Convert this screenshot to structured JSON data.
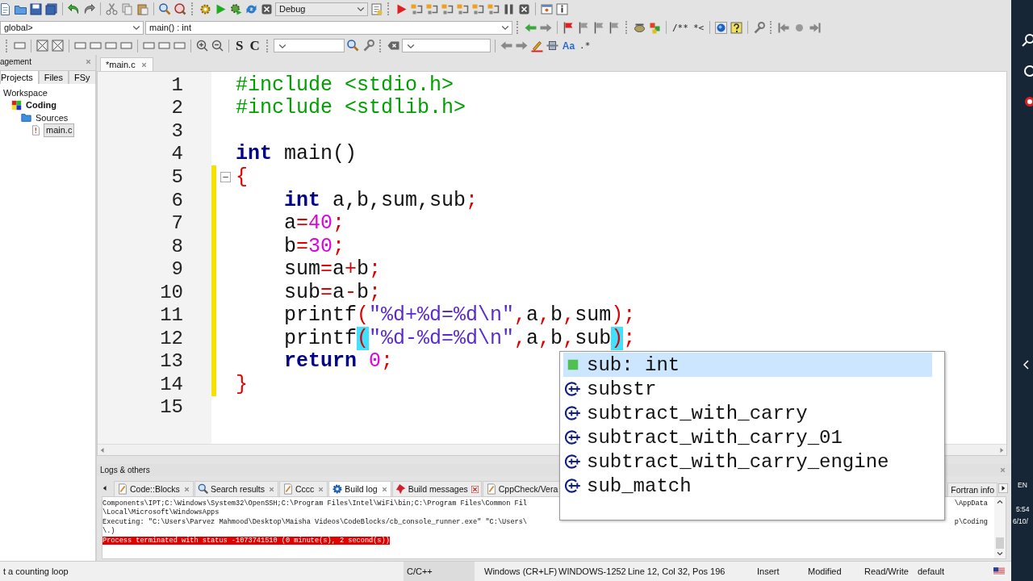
{
  "toolbar_rows": [
    {
      "texts": [
        "Debug"
      ]
    },
    {
      "texts": [
        "global>",
        "main() : int",
        "/**",
        "*<"
      ]
    },
    {
      "texts": [
        "S",
        "C",
        "Aa",
        ".*"
      ]
    }
  ],
  "management_panel": {
    "title": "agement",
    "tabs": [
      {
        "label": "Projects",
        "selected": true
      },
      {
        "label": "Files",
        "selected": false
      },
      {
        "label": "FSy",
        "selected": false
      }
    ],
    "tree": [
      {
        "label": "Workspace",
        "selected": false,
        "children": [
          {
            "label": "Coding",
            "kind": "project",
            "selected": false,
            "children": [
              {
                "label": "Sources",
                "kind": "folder",
                "selected": false,
                "children": [
                  {
                    "label": "main.c",
                    "kind": "file",
                    "selected": true
                  }
                ]
              }
            ]
          }
        ]
      }
    ]
  },
  "editor": {
    "tabs": [
      {
        "label": "*main.c",
        "selected": true
      }
    ],
    "lines": [
      {
        "number": "1",
        "changed": false,
        "fold": false,
        "indent": false,
        "tokens": [
          {
            "kind": "preproc",
            "text": "#include <stdio.h>"
          }
        ]
      },
      {
        "number": "2",
        "changed": false,
        "fold": false,
        "indent": false,
        "tokens": [
          {
            "kind": "preproc",
            "text": "#include <stdlib.h>"
          }
        ]
      },
      {
        "number": "3",
        "changed": false,
        "fold": false,
        "indent": false
      },
      {
        "number": "4",
        "changed": false,
        "fold": false,
        "indent": false,
        "tokens": [
          {
            "kind": "keyword",
            "text": "int"
          },
          {
            "kind": "plain",
            "text": " main()"
          }
        ]
      },
      {
        "number": "5",
        "changed": true,
        "fold": true,
        "indent": false,
        "tokens": [
          {
            "kind": "operator",
            "text": "{"
          }
        ]
      },
      {
        "number": "6",
        "changed": true,
        "fold": false,
        "indent": true,
        "tokens": [
          {
            "kind": "keyword",
            "text": "int"
          },
          {
            "kind": "plain",
            "text": " a,b,sum,sub"
          },
          {
            "kind": "operator",
            "text": ";"
          }
        ]
      },
      {
        "number": "7",
        "changed": true,
        "fold": false,
        "indent": true,
        "tokens": [
          {
            "kind": "plain",
            "text": "a"
          },
          {
            "kind": "operator",
            "text": "="
          },
          {
            "kind": "number",
            "text": "40"
          },
          {
            "kind": "operator",
            "text": ";"
          }
        ]
      },
      {
        "number": "8",
        "changed": true,
        "fold": false,
        "indent": true,
        "tokens": [
          {
            "kind": "plain",
            "text": "b"
          },
          {
            "kind": "operator",
            "text": "="
          },
          {
            "kind": "number",
            "text": "30"
          },
          {
            "kind": "operator",
            "text": ";"
          }
        ]
      },
      {
        "number": "9",
        "changed": true,
        "fold": false,
        "indent": true,
        "tokens": [
          {
            "kind": "plain",
            "text": "sum"
          },
          {
            "kind": "operator",
            "text": "="
          },
          {
            "kind": "plain",
            "text": "a"
          },
          {
            "kind": "operator",
            "text": "+"
          },
          {
            "kind": "plain",
            "text": "b"
          },
          {
            "kind": "operator",
            "text": ";"
          }
        ]
      },
      {
        "number": "10",
        "changed": true,
        "fold": false,
        "indent": true,
        "tokens": [
          {
            "kind": "plain",
            "text": "sub"
          },
          {
            "kind": "operator",
            "text": "="
          },
          {
            "kind": "plain",
            "text": "a"
          },
          {
            "kind": "operator",
            "text": "-"
          },
          {
            "kind": "plain",
            "text": "b"
          },
          {
            "kind": "operator",
            "text": ";"
          }
        ]
      },
      {
        "number": "11",
        "changed": true,
        "fold": false,
        "indent": true,
        "tokens": [
          {
            "kind": "plain",
            "text": "printf"
          },
          {
            "kind": "operator",
            "text": "("
          },
          {
            "kind": "string",
            "text": "\"%d+%d=%d\\n\""
          },
          {
            "kind": "operator",
            "text": ","
          },
          {
            "kind": "plain",
            "text": "a"
          },
          {
            "kind": "operator",
            "text": ","
          },
          {
            "kind": "plain",
            "text": "b"
          },
          {
            "kind": "operator",
            "text": ","
          },
          {
            "kind": "plain",
            "text": "sum"
          },
          {
            "kind": "operator",
            "text": ")"
          },
          {
            "kind": "operator",
            "text": ";"
          }
        ]
      },
      {
        "number": "12",
        "changed": true,
        "fold": false,
        "indent": true,
        "tokens": [
          {
            "kind": "plain",
            "text": "printf"
          },
          {
            "kind": "brace_match",
            "text": "("
          },
          {
            "kind": "string",
            "text": "\"%d-%d=%d\\n\""
          },
          {
            "kind": "operator",
            "text": ","
          },
          {
            "kind": "plain",
            "text": "a"
          },
          {
            "kind": "operator",
            "text": ","
          },
          {
            "kind": "plain",
            "text": "b"
          },
          {
            "kind": "operator",
            "text": ","
          },
          {
            "kind": "plain",
            "text": "sub"
          },
          {
            "kind": "brace_match",
            "text": ")"
          },
          {
            "kind": "operator",
            "text": ";"
          }
        ]
      },
      {
        "number": "13",
        "changed": true,
        "fold": false,
        "indent": true,
        "tokens": [
          {
            "kind": "keyword",
            "text": "return"
          },
          {
            "kind": "number",
            "text": "0"
          },
          {
            "kind": "operator",
            "text": ";"
          }
        ]
      },
      {
        "number": "14",
        "changed": true,
        "fold": false,
        "indent": false,
        "tokens": [
          {
            "kind": "operator",
            "text": "}"
          }
        ]
      },
      {
        "number": "15",
        "changed": false,
        "fold": false,
        "indent": false
      }
    ]
  },
  "autocomplete": {
    "items": [
      {
        "label": "sub: int",
        "kind": "variable",
        "selected": true
      },
      {
        "label": "substr",
        "kind": "function",
        "selected": false
      },
      {
        "label": "subtract_with_carry",
        "kind": "function",
        "selected": false
      },
      {
        "label": "subtract_with_carry_01",
        "kind": "function",
        "selected": false
      },
      {
        "label": "subtract_with_carry_engine",
        "kind": "function",
        "selected": false
      },
      {
        "label": "sub_match",
        "kind": "function",
        "selected": false
      }
    ]
  },
  "logs": {
    "title": "Logs & others",
    "tabs": [
      {
        "label": "Code::Blocks",
        "kind": "note",
        "selected": false
      },
      {
        "label": "Search results",
        "kind": "search",
        "selected": false
      },
      {
        "label": "Cccc",
        "kind": "note",
        "selected": false
      },
      {
        "label": "Build log",
        "kind": "gear",
        "selected": true
      },
      {
        "label": "Build messages",
        "kind": "pin",
        "selected": false
      },
      {
        "label": "CppCheck/Vera",
        "kind": "note",
        "selected": false
      }
    ],
    "tail_tabs": [
      {
        "label": "Fortran info",
        "selected": false
      }
    ],
    "lines": [
      {
        "kind": "plain",
        "text": "Components\\IPT;C:\\Windows\\System32\\OpenSSH;C:\\Program Files\\Intel\\WiFi\\bin;C:\\Program Files\\Common Fil",
        "tail": "\\AppData"
      },
      {
        "kind": "plain",
        "text": "\\Local\\Microsoft\\WindowsApps"
      },
      {
        "kind": "plain",
        "text": "Executing: \"C:\\Users\\Parvez Mahmood\\Desktop\\Maisha Videos\\CodeBlocks/cb_console_runner.exe\" \"C:\\Users\\",
        "tail": "p\\Coding"
      },
      {
        "kind": "plain",
        "text": "\\.)"
      },
      {
        "kind": "error",
        "text": "Process terminated with status -1073741510 (0 minute(s), 2 second(s))"
      }
    ]
  },
  "status_bar": {
    "cells": [
      "t a counting loop",
      "C/C++",
      "Windows (CR+LF)",
      "WINDOWS-1252",
      "Line 12, Col 32, Pos 196",
      "Insert",
      "Modified",
      "Read/Write",
      "default"
    ]
  },
  "taskbar": {
    "texts": [
      "EN",
      "5:54",
      "6/10/"
    ]
  }
}
